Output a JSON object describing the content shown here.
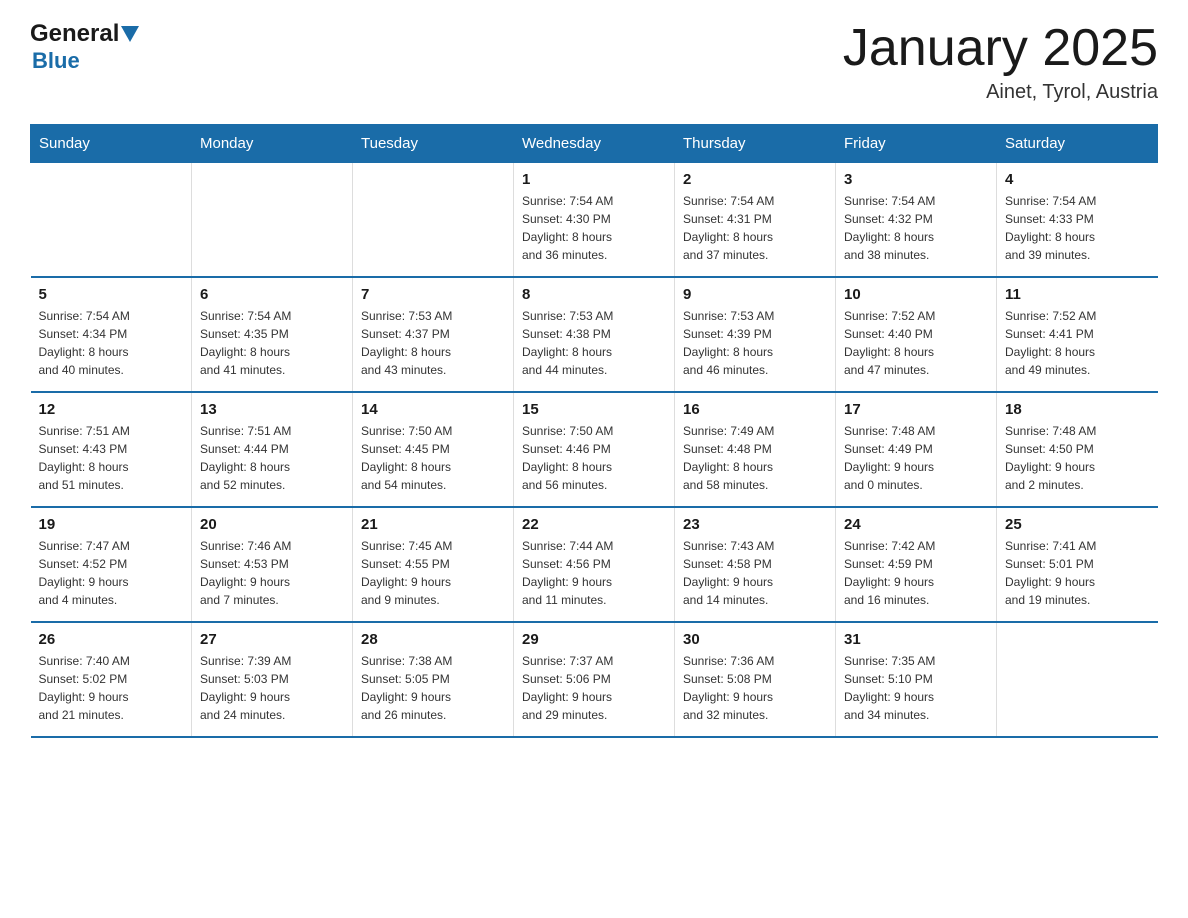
{
  "logo": {
    "text_general": "General",
    "text_blue": "Blue",
    "arrow": "▲"
  },
  "title": "January 2025",
  "subtitle": "Ainet, Tyrol, Austria",
  "days_of_week": [
    "Sunday",
    "Monday",
    "Tuesday",
    "Wednesday",
    "Thursday",
    "Friday",
    "Saturday"
  ],
  "weeks": [
    [
      {
        "day": "",
        "info": ""
      },
      {
        "day": "",
        "info": ""
      },
      {
        "day": "",
        "info": ""
      },
      {
        "day": "1",
        "info": "Sunrise: 7:54 AM\nSunset: 4:30 PM\nDaylight: 8 hours\nand 36 minutes."
      },
      {
        "day": "2",
        "info": "Sunrise: 7:54 AM\nSunset: 4:31 PM\nDaylight: 8 hours\nand 37 minutes."
      },
      {
        "day": "3",
        "info": "Sunrise: 7:54 AM\nSunset: 4:32 PM\nDaylight: 8 hours\nand 38 minutes."
      },
      {
        "day": "4",
        "info": "Sunrise: 7:54 AM\nSunset: 4:33 PM\nDaylight: 8 hours\nand 39 minutes."
      }
    ],
    [
      {
        "day": "5",
        "info": "Sunrise: 7:54 AM\nSunset: 4:34 PM\nDaylight: 8 hours\nand 40 minutes."
      },
      {
        "day": "6",
        "info": "Sunrise: 7:54 AM\nSunset: 4:35 PM\nDaylight: 8 hours\nand 41 minutes."
      },
      {
        "day": "7",
        "info": "Sunrise: 7:53 AM\nSunset: 4:37 PM\nDaylight: 8 hours\nand 43 minutes."
      },
      {
        "day": "8",
        "info": "Sunrise: 7:53 AM\nSunset: 4:38 PM\nDaylight: 8 hours\nand 44 minutes."
      },
      {
        "day": "9",
        "info": "Sunrise: 7:53 AM\nSunset: 4:39 PM\nDaylight: 8 hours\nand 46 minutes."
      },
      {
        "day": "10",
        "info": "Sunrise: 7:52 AM\nSunset: 4:40 PM\nDaylight: 8 hours\nand 47 minutes."
      },
      {
        "day": "11",
        "info": "Sunrise: 7:52 AM\nSunset: 4:41 PM\nDaylight: 8 hours\nand 49 minutes."
      }
    ],
    [
      {
        "day": "12",
        "info": "Sunrise: 7:51 AM\nSunset: 4:43 PM\nDaylight: 8 hours\nand 51 minutes."
      },
      {
        "day": "13",
        "info": "Sunrise: 7:51 AM\nSunset: 4:44 PM\nDaylight: 8 hours\nand 52 minutes."
      },
      {
        "day": "14",
        "info": "Sunrise: 7:50 AM\nSunset: 4:45 PM\nDaylight: 8 hours\nand 54 minutes."
      },
      {
        "day": "15",
        "info": "Sunrise: 7:50 AM\nSunset: 4:46 PM\nDaylight: 8 hours\nand 56 minutes."
      },
      {
        "day": "16",
        "info": "Sunrise: 7:49 AM\nSunset: 4:48 PM\nDaylight: 8 hours\nand 58 minutes."
      },
      {
        "day": "17",
        "info": "Sunrise: 7:48 AM\nSunset: 4:49 PM\nDaylight: 9 hours\nand 0 minutes."
      },
      {
        "day": "18",
        "info": "Sunrise: 7:48 AM\nSunset: 4:50 PM\nDaylight: 9 hours\nand 2 minutes."
      }
    ],
    [
      {
        "day": "19",
        "info": "Sunrise: 7:47 AM\nSunset: 4:52 PM\nDaylight: 9 hours\nand 4 minutes."
      },
      {
        "day": "20",
        "info": "Sunrise: 7:46 AM\nSunset: 4:53 PM\nDaylight: 9 hours\nand 7 minutes."
      },
      {
        "day": "21",
        "info": "Sunrise: 7:45 AM\nSunset: 4:55 PM\nDaylight: 9 hours\nand 9 minutes."
      },
      {
        "day": "22",
        "info": "Sunrise: 7:44 AM\nSunset: 4:56 PM\nDaylight: 9 hours\nand 11 minutes."
      },
      {
        "day": "23",
        "info": "Sunrise: 7:43 AM\nSunset: 4:58 PM\nDaylight: 9 hours\nand 14 minutes."
      },
      {
        "day": "24",
        "info": "Sunrise: 7:42 AM\nSunset: 4:59 PM\nDaylight: 9 hours\nand 16 minutes."
      },
      {
        "day": "25",
        "info": "Sunrise: 7:41 AM\nSunset: 5:01 PM\nDaylight: 9 hours\nand 19 minutes."
      }
    ],
    [
      {
        "day": "26",
        "info": "Sunrise: 7:40 AM\nSunset: 5:02 PM\nDaylight: 9 hours\nand 21 minutes."
      },
      {
        "day": "27",
        "info": "Sunrise: 7:39 AM\nSunset: 5:03 PM\nDaylight: 9 hours\nand 24 minutes."
      },
      {
        "day": "28",
        "info": "Sunrise: 7:38 AM\nSunset: 5:05 PM\nDaylight: 9 hours\nand 26 minutes."
      },
      {
        "day": "29",
        "info": "Sunrise: 7:37 AM\nSunset: 5:06 PM\nDaylight: 9 hours\nand 29 minutes."
      },
      {
        "day": "30",
        "info": "Sunrise: 7:36 AM\nSunset: 5:08 PM\nDaylight: 9 hours\nand 32 minutes."
      },
      {
        "day": "31",
        "info": "Sunrise: 7:35 AM\nSunset: 5:10 PM\nDaylight: 9 hours\nand 34 minutes."
      },
      {
        "day": "",
        "info": ""
      }
    ]
  ]
}
